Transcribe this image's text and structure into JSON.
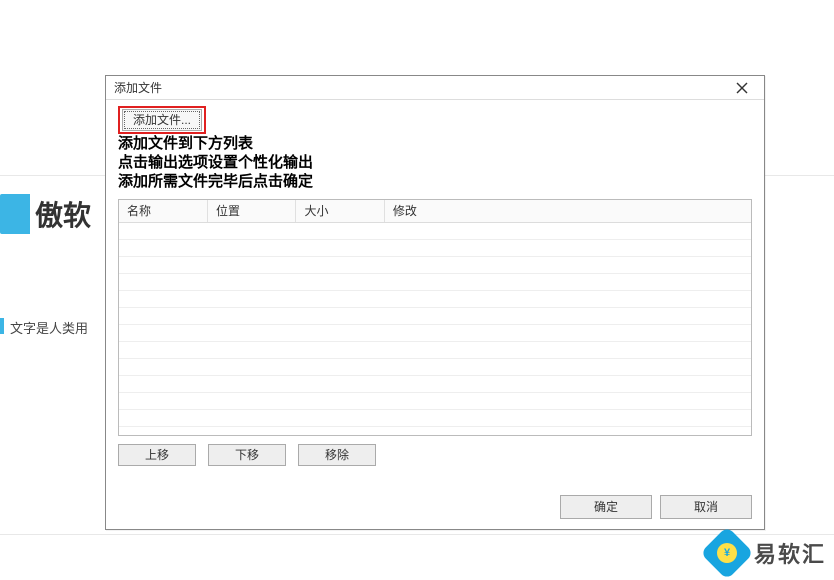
{
  "background": {
    "logo_text": "傲软",
    "sidebar_text": "文字是人类用"
  },
  "dialog": {
    "title": "添加文件",
    "add_file_btn": "添加文件...",
    "hint_line1": "添加文件到下方列表",
    "hint_line2": "点击输出选项设置个性化输出",
    "hint_line3": "添加所需文件完毕后点击确定",
    "columns": {
      "name": "名称",
      "location": "位置",
      "size": "大小",
      "modified": "修改"
    },
    "buttons": {
      "move_up": "上移",
      "move_down": "下移",
      "remove": "移除",
      "ok": "确定",
      "cancel": "取消"
    }
  },
  "watermark": {
    "text": "易软汇"
  }
}
